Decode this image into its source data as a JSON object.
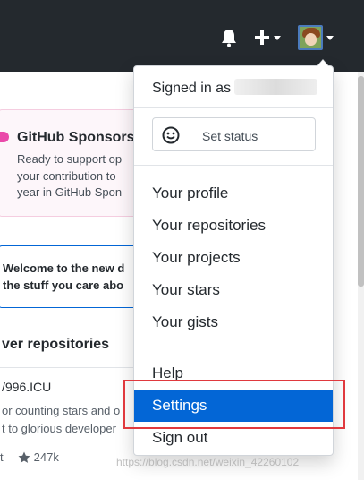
{
  "header": {
    "bell_icon": "bell-icon",
    "plus_icon": "plus-icon",
    "caret_icon": "caret-down-icon"
  },
  "sponsors": {
    "title": "GitHub Sponsors",
    "lines": [
      "Ready to support op",
      "your contribution to",
      "year in GitHub Spon"
    ]
  },
  "welcome": {
    "lines": [
      "Welcome to the new d",
      "the stuff you care abo"
    ]
  },
  "discover": {
    "heading": "ver repositories",
    "repo_name": "/996.ICU",
    "desc_lines": [
      "or counting stars and o",
      "t to glorious developer"
    ],
    "meta_prefix": "t",
    "stars": "247k"
  },
  "dropdown": {
    "signed_in_as": "Signed in as",
    "set_status": "Set status",
    "items": [
      {
        "label": "Your profile"
      },
      {
        "label": "Your repositories"
      },
      {
        "label": "Your projects"
      },
      {
        "label": "Your stars"
      },
      {
        "label": "Your gists"
      }
    ],
    "help": "Help",
    "settings": "Settings",
    "sign_out": "Sign out"
  },
  "watermark": "https://blog.csdn.net/weixin_42260102",
  "colors": {
    "header_bg": "#24292e",
    "active_bg": "#0366d6",
    "highlight": "#e0393e",
    "sponsor_pink": "#ea4aaa"
  }
}
